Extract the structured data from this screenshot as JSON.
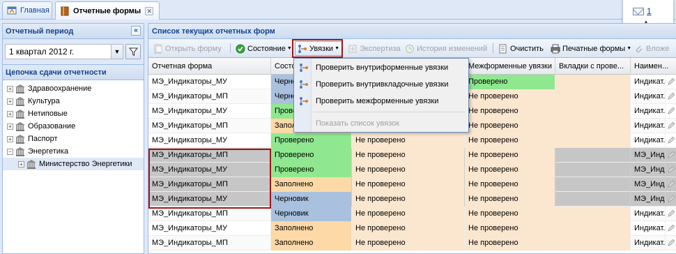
{
  "tabs": [
    {
      "label": "Главная",
      "icon": "home-icon"
    },
    {
      "label": "Отчетные формы",
      "icon": "book-icon",
      "active": true
    }
  ],
  "notifications": {
    "count": "1",
    "icon": "envelope-icon"
  },
  "left": {
    "period_title": "Отчетный период",
    "period_value": "1 квартал 2012 г.",
    "chain_title": "Цепочка сдачи отчетности",
    "tree": [
      {
        "label": "Здравоохранение",
        "level": 0,
        "toggle": "+"
      },
      {
        "label": "Культура",
        "level": 0,
        "toggle": "+"
      },
      {
        "label": "Нетиповые",
        "level": 0,
        "toggle": "+"
      },
      {
        "label": "Образование",
        "level": 0,
        "toggle": "+"
      },
      {
        "label": "Паспорт",
        "level": 0,
        "toggle": "+"
      },
      {
        "label": "Энергетика",
        "level": 0,
        "toggle": "−"
      },
      {
        "label": "Министерство Энергетики",
        "level": 1,
        "toggle": "+",
        "selected": true
      }
    ]
  },
  "right": {
    "title": "Список текущих отчетных форм",
    "toolbar": {
      "open_form": "Открыть форму",
      "state": "Состояние",
      "links": "Увязки",
      "expertise": "Экспертиза",
      "history": "История изменений",
      "clear": "Очистить",
      "print_forms": "Печатные формы",
      "attach": "Вложе"
    },
    "columns": [
      "Отчетная форма",
      "Состояние",
      "",
      "Межформенные увязки",
      "Вкладки с прове...",
      "Наимен..."
    ],
    "rows": [
      {
        "form": "МЭ_Индикаторы_МУ",
        "state": "Черновик",
        "state_cls": "st-draft",
        "inner": "",
        "inter": "Проверено",
        "inter_cls": "st-ok",
        "name": "Индикат...",
        "hl": false
      },
      {
        "form": "МЭ_Индикаторы_МП",
        "state": "Черновик",
        "state_cls": "st-draft",
        "inner": "",
        "inter": "Не проверено",
        "inter_cls": "st-no",
        "name": "Индикат...",
        "hl": false
      },
      {
        "form": "МЭ_Индикаторы_МУ",
        "state": "Проверено",
        "state_cls": "st-ok",
        "inner": "",
        "inter": "Не проверено",
        "inter_cls": "st-no",
        "name": "Индикат...",
        "hl": false
      },
      {
        "form": "МЭ_Индикаторы_МП",
        "state": "Заполнено",
        "state_cls": "st-filled",
        "inner": "",
        "inter": "Не проверено",
        "inter_cls": "st-no",
        "name": "Индикат...",
        "hl": false
      },
      {
        "form": "МЭ_Индикаторы_МУ",
        "state": "Проверено",
        "state_cls": "st-ok",
        "inner": "Не проверено",
        "inter": "Не проверено",
        "inter_cls": "st-no",
        "name": "Индикат...",
        "hl": false
      },
      {
        "form": "МЭ_Индикаторы_МП",
        "state": "Проверено",
        "state_cls": "st-ok",
        "inner": "Не проверено",
        "inter": "Не проверено",
        "inter_cls": "st-no",
        "name": "МЭ_Инд...",
        "hl": true
      },
      {
        "form": "МЭ_Индикаторы_МУ",
        "state": "Проверено",
        "state_cls": "st-ok",
        "inner": "Не проверено",
        "inter": "Не проверено",
        "inter_cls": "st-no",
        "name": "МЭ_Инд...",
        "hl": true
      },
      {
        "form": "МЭ_Индикаторы_МП",
        "state": "Заполнено",
        "state_cls": "st-filled",
        "inner": "Не проверено",
        "inter": "Не проверено",
        "inter_cls": "st-no",
        "name": "МЭ_Инд...",
        "hl": true
      },
      {
        "form": "МЭ_Индикаторы_МУ",
        "state": "Черновик",
        "state_cls": "st-draft",
        "inner": "Не проверено",
        "inter": "Не проверено",
        "inter_cls": "st-no",
        "name": "МЭ_Инд...",
        "hl": true
      },
      {
        "form": "МЭ_Индикаторы_МП",
        "state": "Черновик",
        "state_cls": "st-draft",
        "inner": "Не проверено",
        "inter": "Не проверено",
        "inter_cls": "st-no",
        "name": "Индикат...",
        "hl": false
      },
      {
        "form": "МЭ_Индикаторы_МУ",
        "state": "Заполнено",
        "state_cls": "st-filled",
        "inner": "Не проверено",
        "inter": "Не проверено",
        "inter_cls": "st-no",
        "name": "Индикат...",
        "hl": false
      },
      {
        "form": "МЭ_Индикаторы_МП",
        "state": "Заполнено",
        "state_cls": "st-filled",
        "inner": "Не проверено",
        "inter": "Не проверено",
        "inter_cls": "st-no",
        "name": "Индикат...",
        "hl": false
      }
    ]
  },
  "menu": {
    "items": [
      {
        "label": "Проверить внутриформенные увязки",
        "disabled": false
      },
      {
        "label": "Проверить внутривкладочные увязки",
        "disabled": false
      },
      {
        "label": "Проверить межформенные увязки",
        "disabled": false
      },
      {
        "label": "Показать список увязок",
        "disabled": true
      }
    ]
  },
  "colors": {
    "draft": "#a9c0df",
    "checked": "#8fe88f",
    "filled": "#fcd9a6",
    "not_checked": "#fbe6cf",
    "highlight_box": "#a31515"
  }
}
